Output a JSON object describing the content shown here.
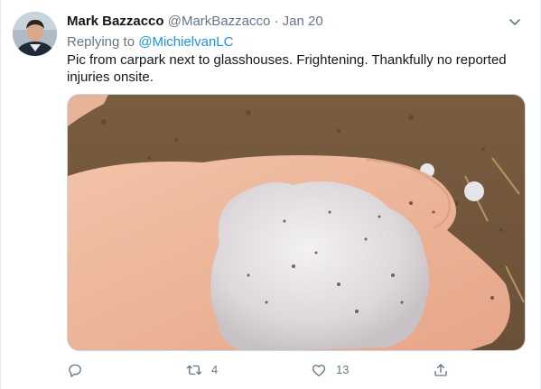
{
  "tweet": {
    "author_name": "Mark Bazzacco",
    "author_handle": "@MarkBazzacco",
    "separator": "·",
    "date": "Jan 20",
    "reply_prefix": "Replying to ",
    "reply_handle": "@MichielvanLC",
    "text_line1": "Pic from carpark next to glasshouses. Frightening. Thankfully no reported",
    "text_line2": "injuries onsite."
  },
  "actions": {
    "reply_count": "",
    "retweet_count": "4",
    "like_count": "13"
  },
  "icons": {
    "menu": "chevron-down-icon",
    "reply": "speech-bubble-icon",
    "retweet": "retweet-icon",
    "like": "heart-icon",
    "share": "share-icon"
  },
  "colors": {
    "link": "#1b95e0",
    "secondary_text": "#657786",
    "primary_text": "#14171a",
    "border": "#e6ecf0"
  }
}
